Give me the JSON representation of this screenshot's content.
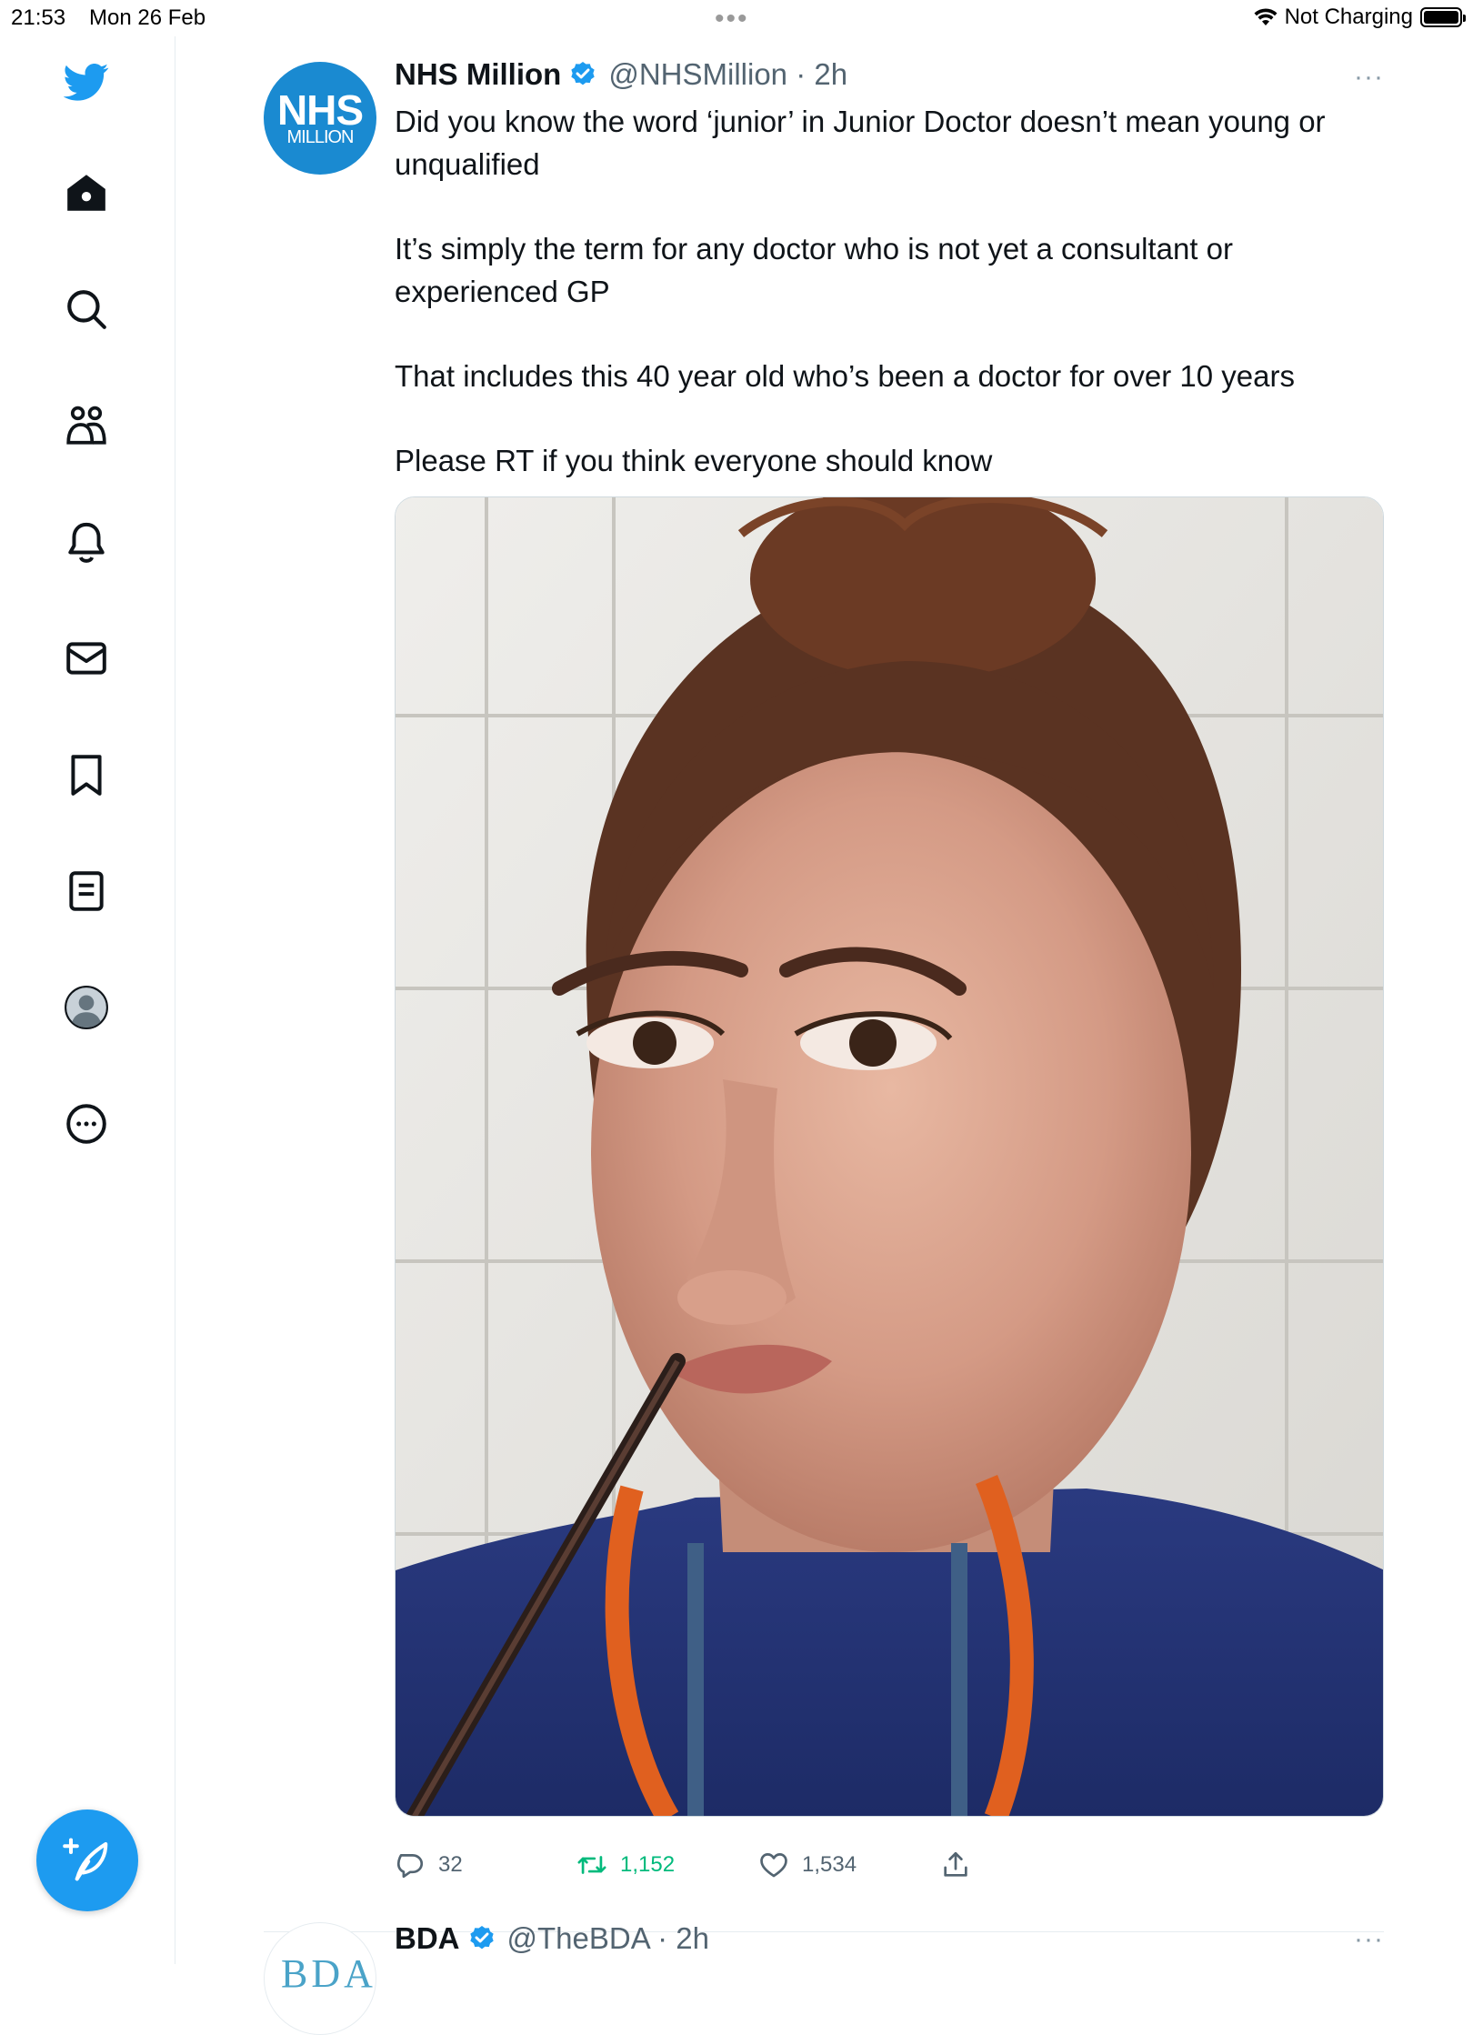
{
  "status_bar": {
    "time": "21:53",
    "date": "Mon 26 Feb",
    "charging": "Not Charging"
  },
  "sidebar": {
    "items": [
      {
        "name": "twitter-logo-icon"
      },
      {
        "name": "home-icon"
      },
      {
        "name": "search-icon"
      },
      {
        "name": "communities-icon"
      },
      {
        "name": "notifications-bell-icon"
      },
      {
        "name": "messages-envelope-icon"
      },
      {
        "name": "bookmarks-icon"
      },
      {
        "name": "lists-icon"
      },
      {
        "name": "profile-avatar-icon"
      },
      {
        "name": "more-options-icon"
      }
    ],
    "compose_icon": "compose-feather-plus-icon"
  },
  "tweet": {
    "avatar_text_top": "NHS",
    "avatar_text_bottom": "MILLION",
    "author_name": "NHS Million",
    "handle_time": "@NHSMillion · 2h",
    "more": "···",
    "paragraphs": [
      "Did you know the word ‘junior’ in Junior Doctor doesn’t mean young or unqualified",
      "It’s simply the term for any doctor who is not yet a consultant or experienced GP",
      "That includes this 40 year old who’s been a doctor for over 10 years",
      "Please RT if you think everyone should know"
    ],
    "media_description": "photo-selfie",
    "actions": {
      "replies": "32",
      "retweets": "1,152",
      "likes": "1,534"
    }
  },
  "next_tweet": {
    "avatar_text": "BDA",
    "author_name": "BDA",
    "handle_time": "@TheBDA · 2h",
    "more": "···"
  },
  "colors": {
    "accent": "#1d9bf0",
    "nhs_blue": "#1a8ad1",
    "retweet_green": "#00ba7c",
    "muted": "#536471"
  }
}
